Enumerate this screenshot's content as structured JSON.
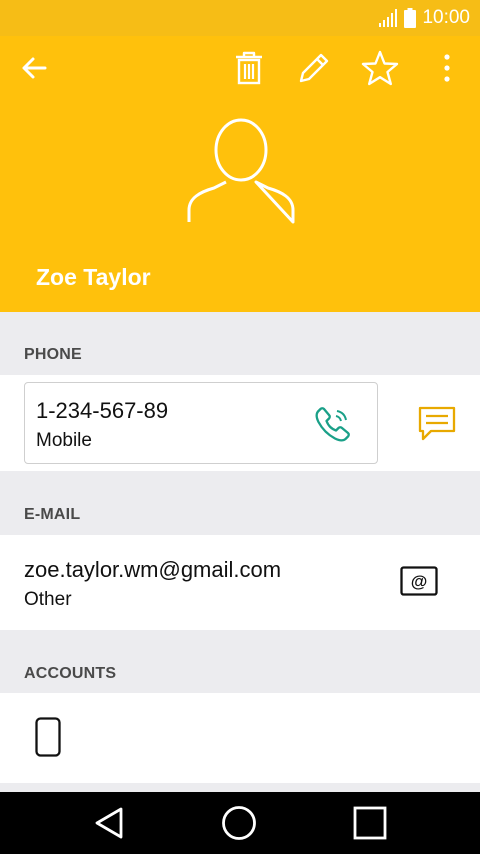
{
  "status_bar": {
    "time": "10:00",
    "signal_icon": "signal-icon",
    "battery_icon": "battery-icon"
  },
  "toolbar": {
    "back_icon": "arrow-left-icon",
    "delete_icon": "trash-icon",
    "edit_icon": "pencil-icon",
    "favorite_icon": "star-outline-icon",
    "more_icon": "more-vertical-icon"
  },
  "contact": {
    "name": "Zoe Taylor",
    "avatar_icon": "person-silhouette-icon"
  },
  "sections": {
    "phone": {
      "label": "PHONE",
      "number": "1-234-567-89",
      "type": "Mobile",
      "call_icon": "phone-icon",
      "message_icon": "message-icon"
    },
    "email": {
      "label": "E-MAIL",
      "address": "zoe.taylor.wm@gmail.com",
      "type": "Other",
      "email_icon": "at-sign-icon"
    },
    "accounts": {
      "label": "ACCOUNTS",
      "device_icon": "phone-device-icon"
    }
  },
  "nav": {
    "back_icon": "triangle-back-icon",
    "home_icon": "circle-home-icon",
    "recents_icon": "square-recents-icon"
  },
  "colors": {
    "header": "#ffc10c",
    "status_bar": "#f6bd16",
    "call_icon": "#1aa088",
    "message_icon": "#e8a900",
    "background": "#ececef"
  }
}
